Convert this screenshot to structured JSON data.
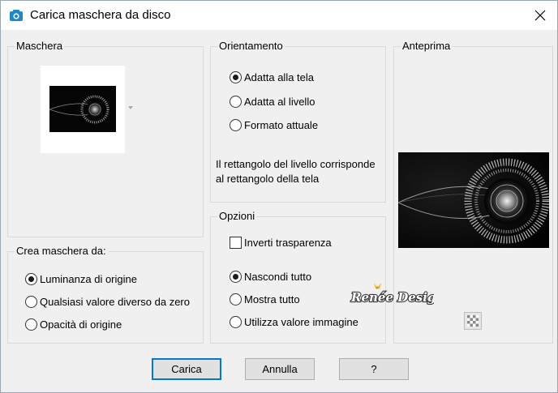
{
  "window": {
    "title": "Carica maschera da disco"
  },
  "maschera": {
    "label": "Maschera"
  },
  "orientamento": {
    "label": "Orientamento",
    "options": [
      "Adatta alla tela",
      "Adatta al livello",
      "Formato attuale"
    ],
    "selected": 0,
    "description": "Il rettangolo del livello corrisponde al rettangolo della tela"
  },
  "anteprima": {
    "label": "Anteprima"
  },
  "crea": {
    "label": "Crea maschera da:",
    "options": [
      "Luminanza di origine",
      "Qualsiasi valore diverso da zero",
      "Opacità di origine"
    ],
    "selected": 0
  },
  "opzioni": {
    "label": "Opzioni",
    "invert_label": "Inverti trasparenza",
    "invert_checked": false,
    "options": [
      "Nascondi tutto",
      "Mostra tutto",
      "Utilizza valore immagine"
    ],
    "selected": 0
  },
  "watermark": {
    "text": "Renée Design"
  },
  "buttons": {
    "load": "Carica",
    "cancel": "Annulla",
    "help": "?"
  },
  "colors": {
    "accent": "#0078d7",
    "title_icon": "#1e88c8",
    "watermark_gold": "#e8c020"
  }
}
